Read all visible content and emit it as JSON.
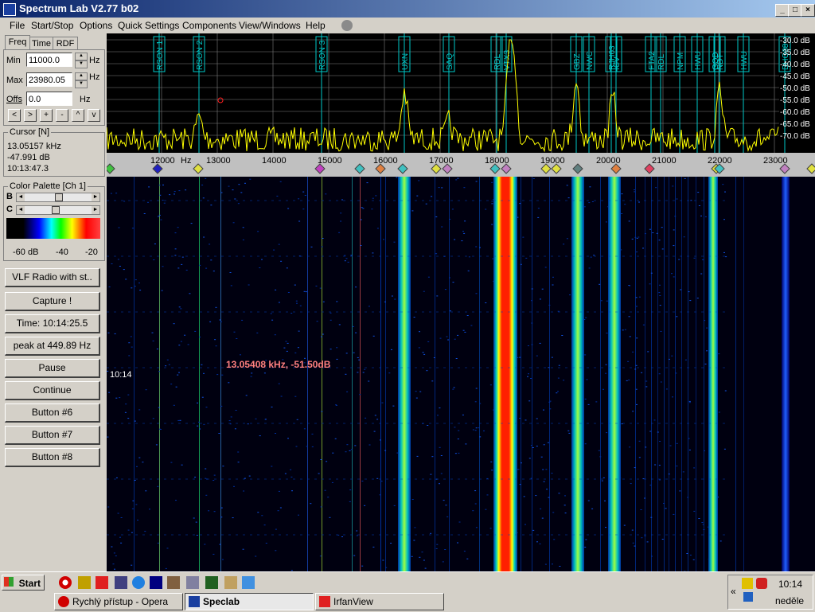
{
  "window": {
    "title": "Spectrum Lab V2.77 b02",
    "min_label": "_",
    "max_label": "□",
    "close_label": "×"
  },
  "menu": {
    "items": [
      "File",
      "Start/Stop",
      "Options",
      "Quick Settings",
      "Components",
      "View/Windows",
      "Help"
    ]
  },
  "tabs": [
    "Freq",
    "Time",
    "RDF"
  ],
  "freq": {
    "min_label": "Min",
    "min_value": "11000.0",
    "min_unit": "Hz",
    "max_label": "Max",
    "max_value": "23980.05",
    "max_unit": "Hz",
    "offs_label": "Offs",
    "offs_value": "0.0",
    "offs_unit": "Hz",
    "nav_buttons": [
      "<",
      ">",
      "+",
      "-",
      "^",
      "v"
    ]
  },
  "cursor": {
    "title": "Cursor [N]",
    "freq": "13.05157 kHz",
    "level": "-47.991 dB",
    "time": "10:13:47.3"
  },
  "palette": {
    "title": "Color Palette [Ch 1]",
    "b_label": "B",
    "c_label": "C",
    "b_value": 0.5,
    "c_value": 0.45,
    "scale": [
      "-60 dB",
      "-40",
      "-20"
    ]
  },
  "buttons": [
    "VLF Radio with st..",
    "Capture !",
    "Time:  10:14:25.5",
    "peak at 449.89 Hz",
    "Pause",
    "Continue",
    "Button #6",
    "Button #7",
    "Button #8"
  ],
  "spectrum": {
    "db_labels": [
      "-30.0 dB",
      "-35.0 dB",
      "-40.0 dB",
      "-45.0 dB",
      "-50.0 dB",
      "-55.0 dB",
      "-60.0 dB",
      "-65.0 dB",
      "-70.0 dB"
    ],
    "freq_ticks": [
      "12000",
      "Hz",
      "13000",
      "14000",
      "15000",
      "16000",
      "17000",
      "18000",
      "19000",
      "20000",
      "21000",
      "22000",
      "23000"
    ],
    "stations": [
      "RSON 1",
      "RSON 2",
      "RSON 3",
      "UXN",
      "SAQ",
      "RDL",
      "VTX3",
      "GBZ",
      "NWC",
      "RJH63",
      "ICV",
      "FTA2",
      "RDL",
      "NPM",
      "HWU",
      "GQD",
      "NDT",
      "HWU",
      "DHO38"
    ]
  },
  "waterfall": {
    "time_label": "10:14",
    "cursor_readout": "13.05408 kHz, -51.50dB"
  },
  "taskbar": {
    "start": "Start",
    "tasks": [
      "Rychlý přístup - Opera",
      "Speclab",
      "IrfanView"
    ],
    "clock": "10:14",
    "day": "neděle",
    "chevron": "«"
  },
  "colors": {
    "spectrum_trace": "#ffff00",
    "marker_line": "#00c8c8",
    "title_gradient_start": "#0a246a",
    "readout": "#ff8080"
  }
}
